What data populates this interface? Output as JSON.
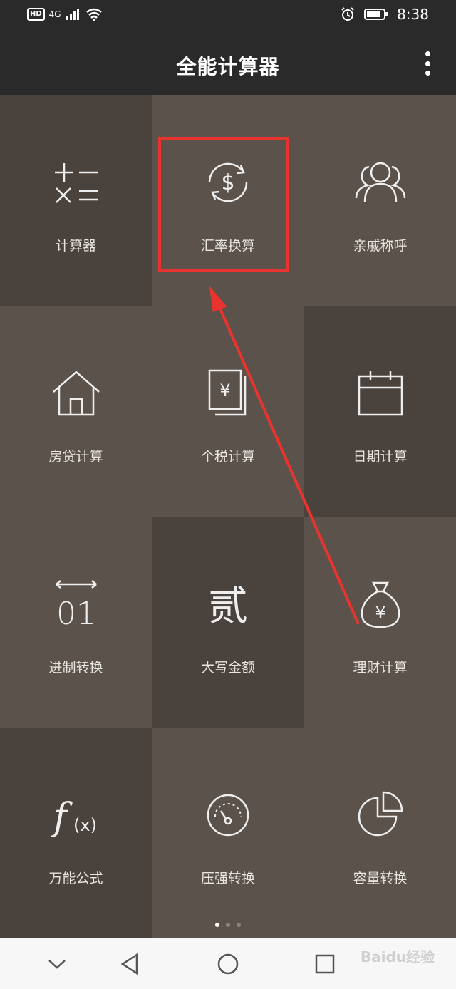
{
  "status_bar": {
    "hd": "HD",
    "signal": "4G",
    "time": "8:38"
  },
  "app": {
    "title": "全能计算器"
  },
  "tiles": [
    {
      "label": "计算器",
      "icon": "plus-minus-times-equals-icon"
    },
    {
      "label": "汇率换算",
      "icon": "currency-exchange-icon"
    },
    {
      "label": "亲戚称呼",
      "icon": "people-group-icon"
    },
    {
      "label": "房贷计算",
      "icon": "house-icon"
    },
    {
      "label": "个税计算",
      "icon": "tax-document-icon"
    },
    {
      "label": "日期计算",
      "icon": "calendar-icon"
    },
    {
      "label": "进制转换",
      "icon": "binary-icon"
    },
    {
      "label": "大写金额",
      "icon": "chinese-numeral-icon"
    },
    {
      "label": "理财计算",
      "icon": "money-bag-icon"
    },
    {
      "label": "万能公式",
      "icon": "function-icon"
    },
    {
      "label": "压强转换",
      "icon": "pressure-gauge-icon"
    },
    {
      "label": "容量转换",
      "icon": "pie-chart-icon"
    }
  ],
  "icon_text": {
    "binary": "01",
    "numeral": "贰",
    "fx": "f",
    "fx_arg": "(x)",
    "yen": "¥",
    "dollar": "$"
  },
  "pager": {
    "pages": 3,
    "active": 0
  },
  "watermark": "Baidu经验",
  "colors": {
    "highlight": "#e8332f",
    "appbar": "#2a2a2a"
  }
}
